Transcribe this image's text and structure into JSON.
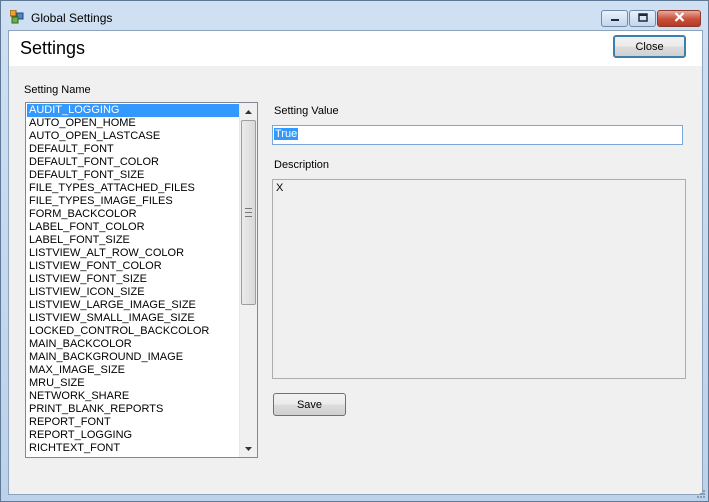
{
  "window": {
    "title": "Global Settings"
  },
  "header": {
    "title": "Settings",
    "close_label": "Close"
  },
  "settings_list": {
    "label": "Setting Name",
    "selected_index": 0,
    "items": [
      "AUDIT_LOGGING",
      "AUTO_OPEN_HOME",
      "AUTO_OPEN_LASTCASE",
      "DEFAULT_FONT",
      "DEFAULT_FONT_COLOR",
      "DEFAULT_FONT_SIZE",
      "FILE_TYPES_ATTACHED_FILES",
      "FILE_TYPES_IMAGE_FILES",
      "FORM_BACKCOLOR",
      "LABEL_FONT_COLOR",
      "LABEL_FONT_SIZE",
      "LISTVIEW_ALT_ROW_COLOR",
      "LISTVIEW_FONT_COLOR",
      "LISTVIEW_FONT_SIZE",
      "LISTVIEW_ICON_SIZE",
      "LISTVIEW_LARGE_IMAGE_SIZE",
      "LISTVIEW_SMALL_IMAGE_SIZE",
      "LOCKED_CONTROL_BACKCOLOR",
      "MAIN_BACKCOLOR",
      "MAIN_BACKGROUND_IMAGE",
      "MAX_IMAGE_SIZE",
      "MRU_SIZE",
      "NETWORK_SHARE",
      "PRINT_BLANK_REPORTS",
      "REPORT_FONT",
      "REPORT_LOGGING",
      "RICHTEXT_FONT"
    ]
  },
  "detail": {
    "value_label": "Setting Value",
    "value": "True",
    "description_label": "Description",
    "description": "X",
    "save_label": "Save"
  },
  "colors": {
    "selection": "#3399ff",
    "title_bar": "#cfe0f2",
    "close_caption": "#c84f3a"
  },
  "icons": {
    "app": "app-icon",
    "minimize": "minimize-icon",
    "maximize": "maximize-icon",
    "close": "close-icon",
    "scroll_up": "scroll-up-arrow-icon",
    "scroll_down": "scroll-down-arrow-icon"
  }
}
